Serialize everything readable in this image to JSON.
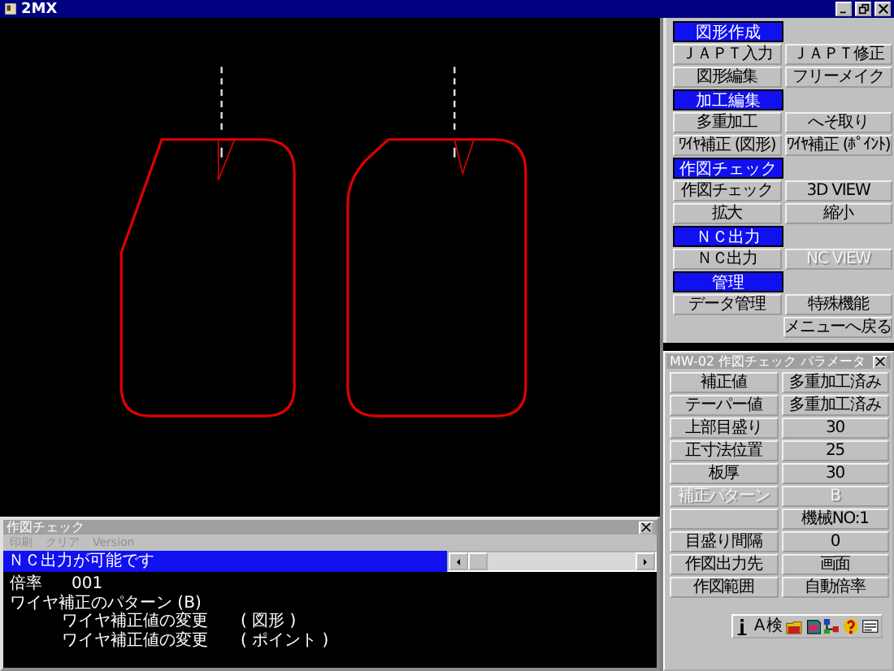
{
  "window": {
    "title": "2MX"
  },
  "menu_panel": {
    "rows": [
      {
        "kind": "header",
        "label": "図形作成"
      },
      {
        "kind": "buttons",
        "cells": [
          {
            "kind": "button",
            "label": "ＪＡＰＴ入力",
            "disabled": false
          },
          {
            "kind": "button",
            "label": "ＪＡＰＴ修正",
            "disabled": false
          }
        ]
      },
      {
        "kind": "buttons",
        "cells": [
          {
            "kind": "button",
            "label": "図形編集",
            "disabled": false
          },
          {
            "kind": "button",
            "label": "フリーメイク",
            "disabled": false
          }
        ]
      },
      {
        "kind": "header",
        "label": "加工編集"
      },
      {
        "kind": "buttons",
        "cells": [
          {
            "kind": "button",
            "label": "多重加工",
            "disabled": false
          },
          {
            "kind": "button",
            "label": "へそ取り",
            "disabled": false
          }
        ]
      },
      {
        "kind": "buttons",
        "cells": [
          {
            "kind": "button",
            "label": "ﾜｲﾔ補正 (図形)",
            "disabled": false
          },
          {
            "kind": "button",
            "label": "ﾜｲﾔ補正 (ﾎﾟｲﾝﾄ)",
            "disabled": false
          }
        ]
      },
      {
        "kind": "header",
        "label": "作図チェック"
      },
      {
        "kind": "buttons",
        "cells": [
          {
            "kind": "button",
            "label": "作図チェック",
            "disabled": false
          },
          {
            "kind": "button",
            "label": "3D VIEW",
            "disabled": false
          }
        ]
      },
      {
        "kind": "buttons",
        "cells": [
          {
            "kind": "button",
            "label": "拡大",
            "disabled": false
          },
          {
            "kind": "button",
            "label": "縮小",
            "disabled": false
          }
        ]
      },
      {
        "kind": "header",
        "label": "ＮＣ出力"
      },
      {
        "kind": "buttons",
        "cells": [
          {
            "kind": "button",
            "label": "ＮＣ出力",
            "disabled": false
          },
          {
            "kind": "button",
            "label": "NC VIEW",
            "disabled": true
          }
        ]
      },
      {
        "kind": "header",
        "label": "管理"
      },
      {
        "kind": "buttons",
        "cells": [
          {
            "kind": "button",
            "label": "データ管理",
            "disabled": false
          },
          {
            "kind": "button",
            "label": "特殊機能",
            "disabled": false
          }
        ]
      },
      {
        "kind": "buttons",
        "cells": [
          {
            "kind": "blank"
          },
          {
            "kind": "button",
            "label": "メニューへ戻る",
            "disabled": false
          }
        ]
      }
    ]
  },
  "parameter_panel": {
    "title": "MW-02 作図チェック パラメータ",
    "rows": [
      {
        "label": "補正値",
        "value": "多重加工済み",
        "disabled": false
      },
      {
        "label": "テーパー値",
        "value": "多重加工済み",
        "disabled": false
      },
      {
        "label": "上部目盛り",
        "value": "30",
        "disabled": false
      },
      {
        "label": "正寸法位置",
        "value": "25",
        "disabled": false
      },
      {
        "label": "板厚",
        "value": "30",
        "disabled": false
      },
      {
        "label": "補正パターン",
        "value": "B",
        "disabled": true
      },
      {
        "value": "機械NO:1",
        "disabled": false
      },
      {
        "label": "目盛り間隔",
        "value": "0",
        "disabled": false
      },
      {
        "label": "作図出力先",
        "value": "画面",
        "disabled": false
      },
      {
        "label": "作図範囲",
        "value": "自動倍率",
        "disabled": false
      }
    ],
    "toolbar": [
      {
        "kind": "info"
      },
      {
        "kind": "text",
        "text": "A"
      },
      {
        "kind": "text",
        "text": "検"
      },
      {
        "kind": "folder"
      },
      {
        "kind": "book"
      },
      {
        "kind": "network"
      },
      {
        "kind": "help"
      },
      {
        "kind": "card"
      }
    ]
  },
  "check_window": {
    "title": "作図チェック",
    "menu": [
      "印刷",
      "クリア",
      "Version"
    ],
    "status": "ＮＣ出力が可能です",
    "log": [
      {
        "kind": "pair",
        "label": "倍率",
        "value": "001"
      },
      {
        "kind": "line",
        "text": "ワイヤ補正のパターン (B)"
      },
      {
        "kind": "sub",
        "label": "ワイヤ補正値の変更",
        "value": "( 図形 )"
      },
      {
        "kind": "sub",
        "label": "ワイヤ補正値の変更",
        "value": "( ポイント )"
      }
    ]
  }
}
